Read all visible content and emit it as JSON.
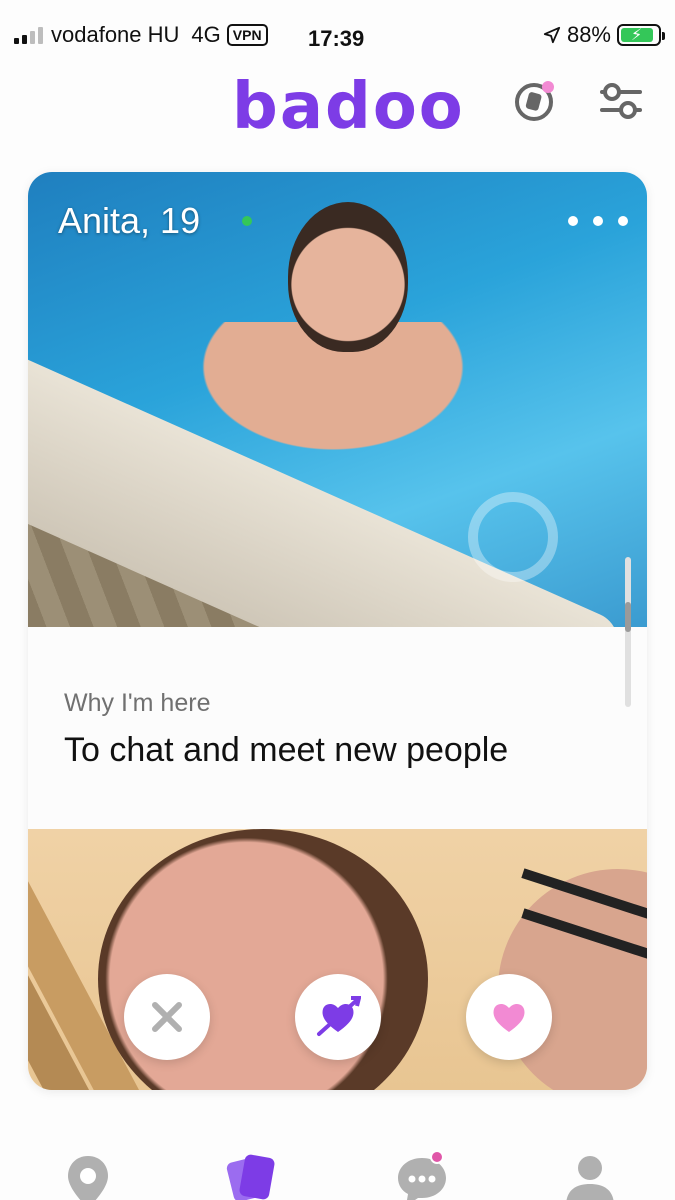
{
  "status_bar": {
    "carrier": "vodafone HU",
    "network": "4G",
    "vpn": "VPN",
    "time": "17:39",
    "battery": "88%",
    "battery_level": 0.88,
    "icons": [
      "signal-icon",
      "location-arrow-icon",
      "battery-charging-icon"
    ]
  },
  "header": {
    "logo": "badoo",
    "icons": [
      "spotlight-icon",
      "filters-icon"
    ],
    "accent_color": "#7d3ce6"
  },
  "profile": {
    "name": "Anita, 19",
    "online": true,
    "about_label": "Why I'm here",
    "about_value": "To chat and meet new people"
  },
  "actions": {
    "icons": [
      "close-icon",
      "heart-arrow-icon",
      "heart-icon"
    ]
  },
  "bottom_nav": {
    "items": [
      {
        "icon": "location-pin-icon"
      },
      {
        "icon": "encounters-cards-icon",
        "active": true
      },
      {
        "icon": "chat-bubble-icon",
        "badge": true
      },
      {
        "icon": "person-icon"
      }
    ]
  },
  "colors": {
    "brand": "#7d3ce6",
    "online": "#34c759",
    "like_pink": "#f28ad3",
    "inactive_icon": "#b0b0b0"
  }
}
